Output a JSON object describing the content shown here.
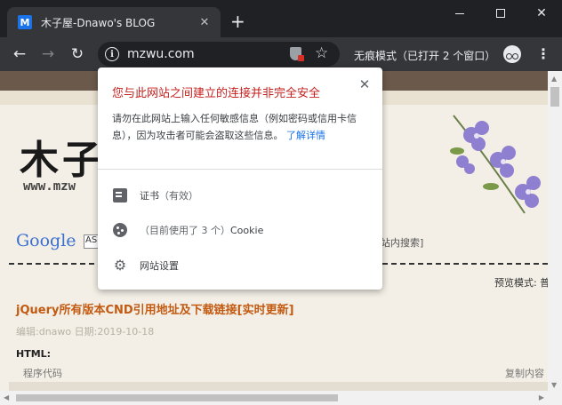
{
  "tab": {
    "favicon_letter": "M",
    "title": "木子屋-Dnawo's BLOG",
    "close": "✕"
  },
  "newtab": "+",
  "window": {
    "close": "✕"
  },
  "toolbar": {
    "back": "←",
    "forward": "→",
    "reload": "↻",
    "url": "mzwu.com",
    "star": "☆",
    "incognito_label": "无痕模式（已打开 2 个窗口）",
    "menu": "⋮"
  },
  "page": {
    "logo_text": "木子",
    "logo_sub": "www.mzw",
    "google_label": "Google",
    "search_box_value": "AS",
    "site_search": "站内搜索]",
    "preview_mode": "预览模式: 普",
    "article_title": "jQuery所有版本CND引用地址及下载链接[实时更新]",
    "article_meta": "编辑:dnawo   日期:2019-10-18",
    "html_label": "HTML:",
    "code_label": "程序代码",
    "copy_label": "复制内容"
  },
  "popup": {
    "title": "您与此网站之间建立的连接并非完全安全",
    "close": "✕",
    "desc": "请勿在此网站上输入任何敏感信息（例如密码或信用卡信息），因为攻击者可能会盗取这些信息。",
    "link": "了解详情",
    "cert_label": "证书",
    "cert_status": "（有效）",
    "cookie_prefix": "（目前使用了 3 个）",
    "cookie_label": "Cookie",
    "settings_label": "网站设置",
    "gear": "⚙"
  },
  "colors": {
    "warning_red": "#c5221f",
    "link_blue": "#1a73e8",
    "title_orange": "#c35a12"
  }
}
